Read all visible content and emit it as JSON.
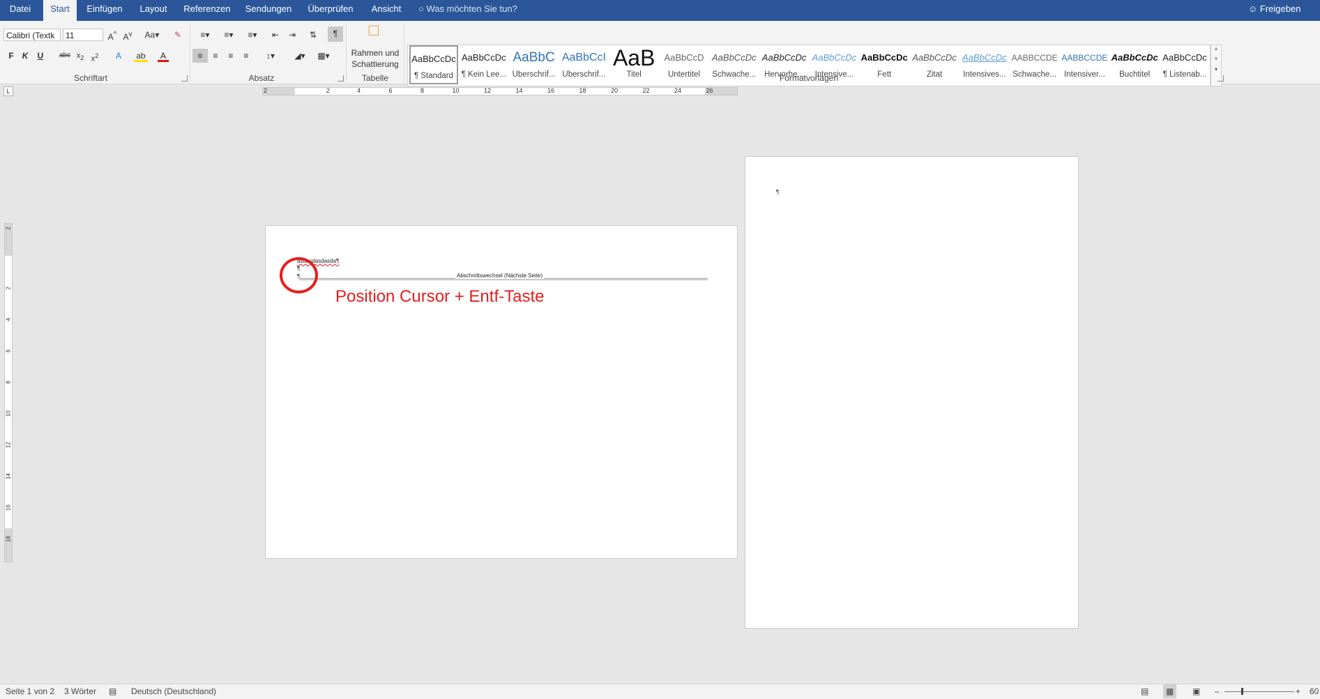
{
  "tabs": [
    {
      "label": "Datei",
      "active": false
    },
    {
      "label": "Start",
      "active": true
    },
    {
      "label": "Einfügen",
      "active": false
    },
    {
      "label": "Layout",
      "active": false
    },
    {
      "label": "Referenzen",
      "active": false
    },
    {
      "label": "Sendungen",
      "active": false
    },
    {
      "label": "Überprüfen",
      "active": false
    },
    {
      "label": "Ansicht",
      "active": false
    }
  ],
  "tellme": "Was möchten Sie tun?",
  "share": "Freigeben",
  "font": {
    "name": "Calibri (Textk",
    "size": "11"
  },
  "groups": {
    "font": "Schriftart",
    "paragraph": "Absatz",
    "table": "Tabelle",
    "styles": "Formatvorlagen"
  },
  "borders_button": {
    "line1": "Rahmen und",
    "line2": "Schattierung"
  },
  "styles": [
    {
      "preview": "AaBbCcDc",
      "name": "¶ Standard",
      "selected": true
    },
    {
      "preview": "AaBbCcDc",
      "name": "¶ Kein Lee..."
    },
    {
      "preview": "AaBbC",
      "name": "Überschrif..."
    },
    {
      "preview": "AaBbCcI",
      "name": "Überschrif..."
    },
    {
      "preview": "AaB",
      "name": "Titel"
    },
    {
      "preview": "AaBbCcD",
      "name": "Untertitel"
    },
    {
      "preview": "AaBbCcDc",
      "name": "Schwache..."
    },
    {
      "preview": "AaBbCcDc",
      "name": "Hervorhe..."
    },
    {
      "preview": "AaBbCcDc",
      "name": "Intensive..."
    },
    {
      "preview": "AaBbCcDc",
      "name": "Fett"
    },
    {
      "preview": "AaBbCcDc",
      "name": "Zitat"
    },
    {
      "preview": "AaBbCcDc",
      "name": "Intensives..."
    },
    {
      "preview": "AABBCCDE",
      "name": "Schwache..."
    },
    {
      "preview": "AABBCCDE",
      "name": "Intensiver..."
    },
    {
      "preview": "AaBbCcDc",
      "name": "Buchtitel"
    },
    {
      "preview": "AaBbCcDc",
      "name": "¶ Listenab..."
    }
  ],
  "ruler_h": [
    "2",
    "2",
    "4",
    "6",
    "8",
    "10",
    "12",
    "14",
    "16",
    "18",
    "20",
    "22",
    "24",
    "26"
  ],
  "ruler_v": [
    "2",
    "2",
    "4",
    "6",
    "8",
    "10",
    "12",
    "14",
    "16",
    "18"
  ],
  "page1": {
    "line1": "asdasdasdasda¶",
    "pilcrow1": "¶",
    "pilcrow2": "¶",
    "section_break": "Abschnittswechsel (Nächste Seite)",
    "annotation": "Position Cursor + Entf-Taste"
  },
  "page2": {
    "pilcrow": "¶"
  },
  "status": {
    "page": "Seite 1 von 2",
    "words": "3 Wörter",
    "language": "Deutsch (Deutschland)",
    "zoom": "60"
  },
  "colors": {
    "accent": "#2b579a",
    "annotation": "#e61e1e"
  }
}
